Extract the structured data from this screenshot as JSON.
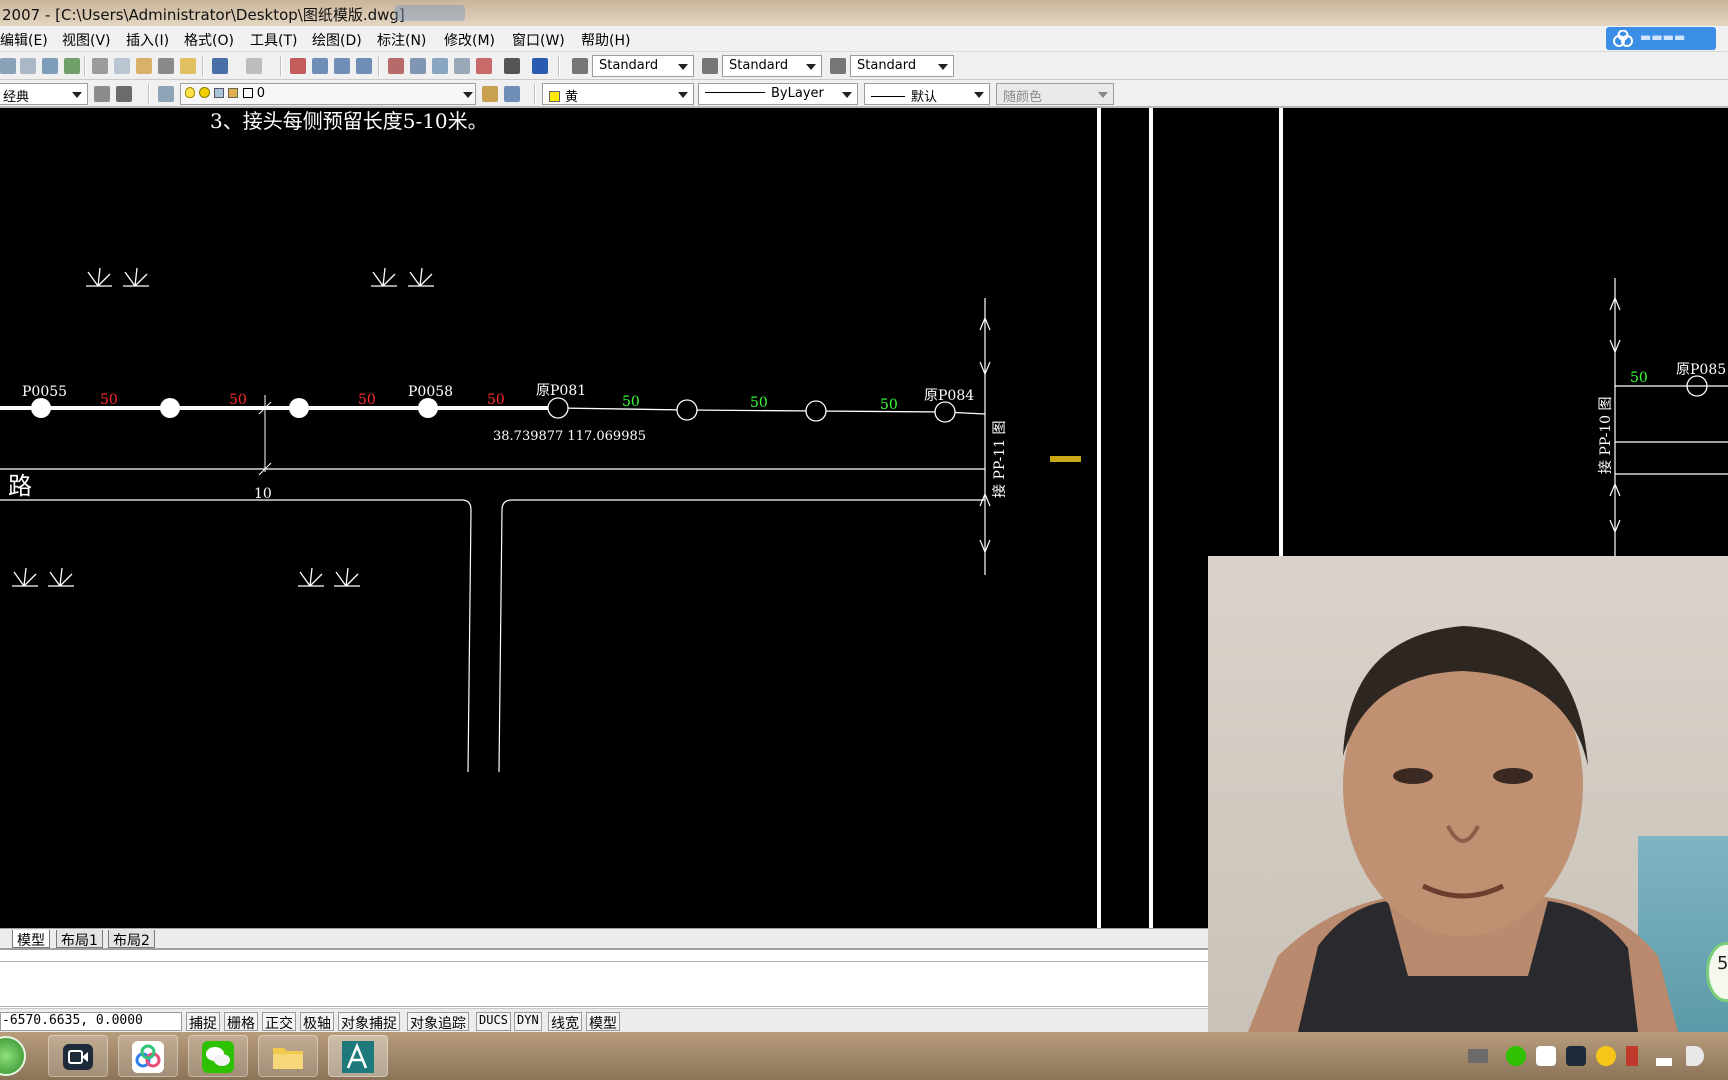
{
  "window": {
    "title": "2007 - [C:\\Users\\Administrator\\Desktop\\图纸模版.dwg]"
  },
  "menu": {
    "items": [
      "编辑(E)",
      "视图(V)",
      "插入(I)",
      "格式(O)",
      "工具(T)",
      "绘图(D)",
      "标注(N)",
      "修改(M)",
      "窗口(W)",
      "帮助(H)"
    ]
  },
  "toolbar1": {
    "text_style": "Standard",
    "dim_style": "Standard",
    "table_style": "Standard"
  },
  "toolbar2": {
    "workspace": "经典",
    "layer": "0",
    "color": "黄",
    "linetype": "ByLayer",
    "lineweight": "默认",
    "plotstyle": "随颜色"
  },
  "drawing": {
    "note": "3、接头每侧预留长度5-10米。",
    "road_label": "路",
    "dimension": "10",
    "coord_text": "38.739877 117.069985",
    "poles": [
      "P0055",
      "P0058",
      "原P081",
      "原P084",
      "原P085"
    ],
    "spans": {
      "red": [
        "50",
        "50",
        "50",
        "50"
      ],
      "green": [
        "50",
        "50",
        "50",
        "50"
      ]
    },
    "connect_labels": [
      "接 PP-11 图",
      "接 PP-10 图"
    ]
  },
  "tabs": [
    "模型",
    "布局1",
    "布局2"
  ],
  "status": {
    "coords": "-6570.6635, 0.0000",
    "buttons": [
      "捕捉",
      "栅格",
      "正交",
      "极轴",
      "对象捕捉",
      "对象追踪",
      "DUCS",
      "DYN",
      "线宽",
      "模型"
    ]
  },
  "overlay": {
    "floating_number": "5"
  },
  "colors": {
    "span_red": "#ff2a2a",
    "span_green": "#3cff3c",
    "layer_yellow": "#ffea00"
  }
}
